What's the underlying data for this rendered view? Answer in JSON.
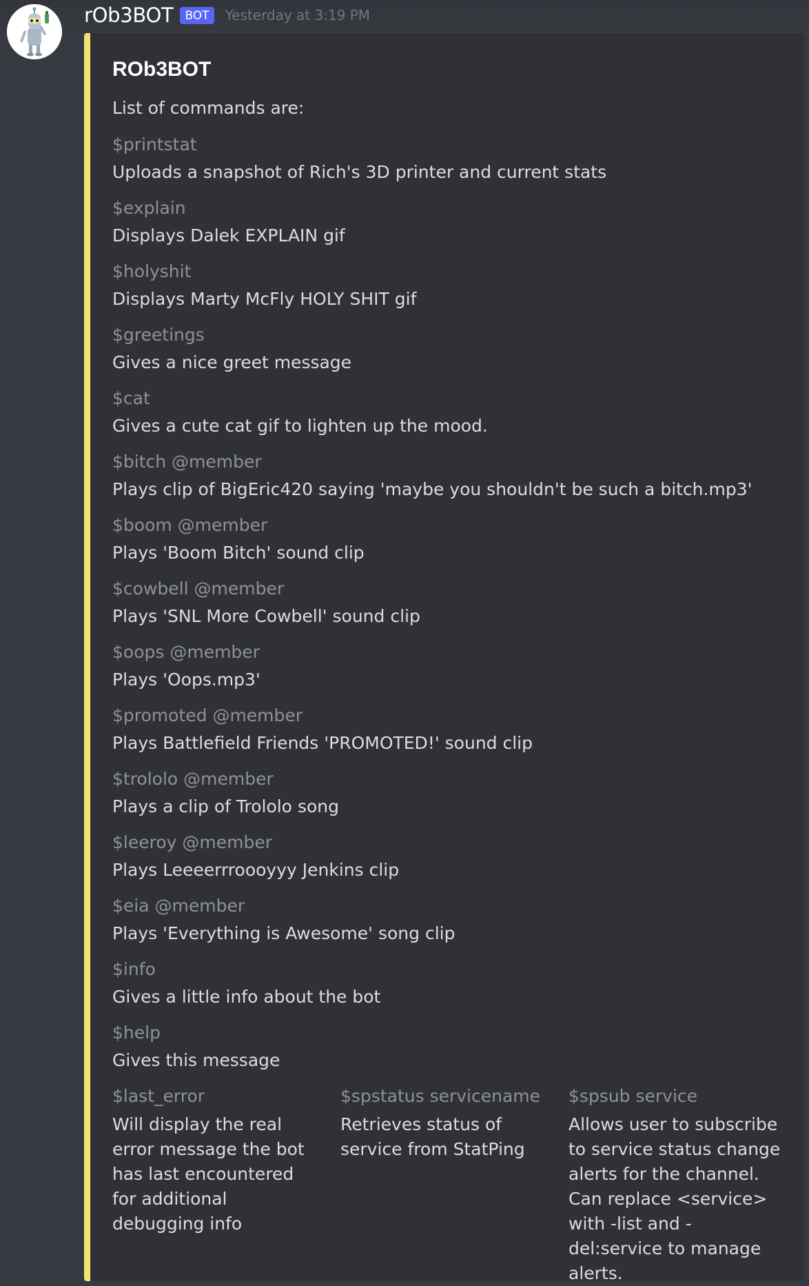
{
  "message": {
    "username": "rOb3BOT",
    "bot_tag": "BOT",
    "timestamp": "Yesterday at 3:19 PM"
  },
  "embed": {
    "accent_color": "#f3e36d",
    "title": "ROb3BOT",
    "description": "List of commands are:",
    "fields": [
      {
        "name": "$printstat",
        "value": "Uploads a snapshot of Rich's 3D printer and current stats"
      },
      {
        "name": "$explain",
        "value": "Displays Dalek EXPLAIN gif"
      },
      {
        "name": "$holyshit",
        "value": "Displays Marty McFly HOLY SHIT gif"
      },
      {
        "name": "$greetings",
        "value": "Gives a nice greet message"
      },
      {
        "name": "$cat",
        "value": "Gives a cute cat gif to lighten up the mood."
      },
      {
        "name": "$bitch @member",
        "value": "Plays clip of BigEric420 saying 'maybe you shouldn't be such a bitch.mp3'"
      },
      {
        "name": "$boom @member",
        "value": "Plays 'Boom Bitch' sound clip"
      },
      {
        "name": "$cowbell @member",
        "value": "Plays 'SNL More Cowbell' sound clip"
      },
      {
        "name": "$oops @member",
        "value": "Plays 'Oops.mp3'"
      },
      {
        "name": "$promoted @member",
        "value": "Plays Battlefield Friends 'PROMOTED!' sound clip"
      },
      {
        "name": "$trololo @member",
        "value": "Plays a clip of Trololo song"
      },
      {
        "name": "$leeroy @member",
        "value": "Plays Leeeerrroooyyy Jenkins clip"
      },
      {
        "name": "$eia @member",
        "value": "Plays 'Everything is Awesome' song clip"
      },
      {
        "name": "$info",
        "value": "Gives a little info about the bot"
      },
      {
        "name": "$help",
        "value": "Gives this message"
      }
    ],
    "inline_fields": [
      {
        "name": "$last_error",
        "value": "Will display the real error message the bot has last encountered for additional debugging info"
      },
      {
        "name": "$spstatus servicename",
        "value": "Retrieves status of service from StatPing"
      },
      {
        "name": "$spsub service",
        "value": "Allows user to subscribe to service status change alerts for the channel. Can replace <service> with -list and -del:service to manage alerts."
      }
    ]
  }
}
